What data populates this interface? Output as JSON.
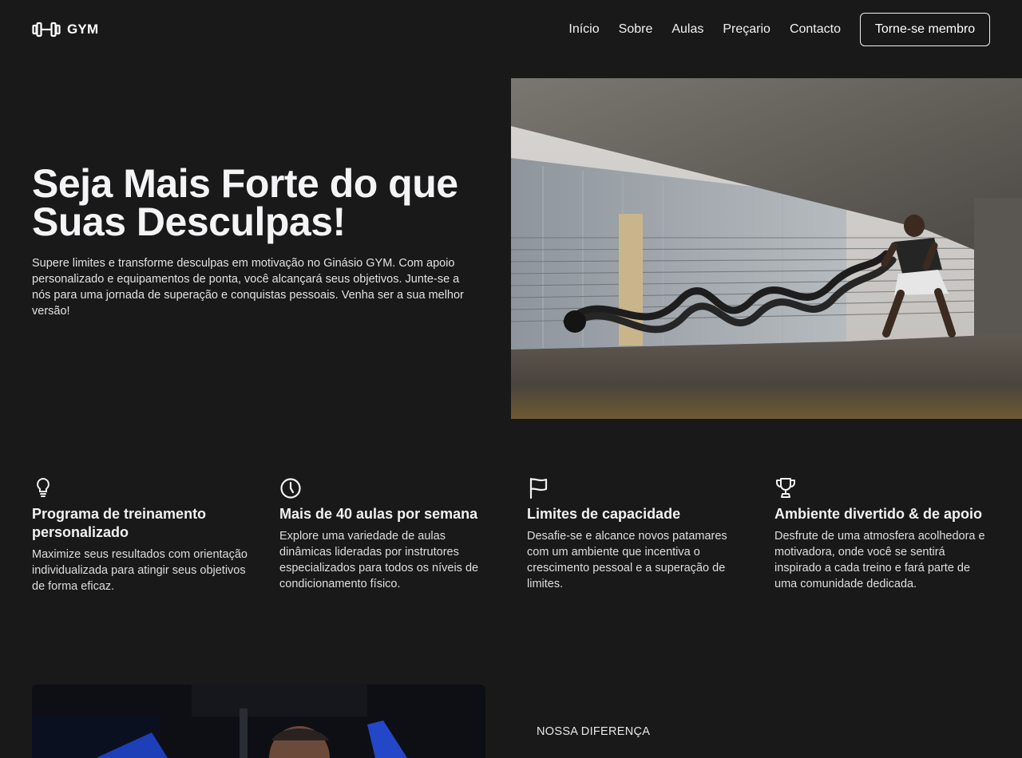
{
  "brand": {
    "name": "GYM",
    "icon": "dumbbell-icon"
  },
  "nav": {
    "items": [
      {
        "label": "Início"
      },
      {
        "label": "Sobre"
      },
      {
        "label": "Aulas"
      },
      {
        "label": "Preçario"
      },
      {
        "label": "Contacto"
      }
    ],
    "cta_label": "Torne-se membro"
  },
  "hero": {
    "title": "Seja Mais Forte do que Suas Desculpas!",
    "text": "Supere limites e transforme desculpas em motivação no Ginásio GYM. Com apoio personalizado e equipamentos de ponta, você alcançará seus objetivos. Junte-se a nós para uma jornada de superação e conquistas pessoais. Venha ser a sua melhor versão!",
    "image": "battle-ropes-athlete-photo"
  },
  "features": [
    {
      "icon": "lightbulb-icon",
      "title": "Programa de treinamento personalizado",
      "text": "Maximize seus resultados com orientação individualizada para atingir seus objetivos de forma eficaz."
    },
    {
      "icon": "clock-icon",
      "title": "Mais de 40 aulas por semana",
      "text": "Explore uma variedade de aulas dinâmicas lideradas por instrutores especializados para todos os níveis de condicionamento físico."
    },
    {
      "icon": "flag-icon",
      "title": "Limites de capacidade",
      "text": "Desafie-se e alcance novos patamares com um ambiente que incentiva o crescimento pessoal e a superação de limites."
    },
    {
      "icon": "trophy-icon",
      "title": "Ambiente divertido & de apoio",
      "text": "Desfrute de uma atmosfera acolhedora e motivadora, onde você se sentirá inspirado a cada treino e fará parte de uma comunidade dedicada."
    }
  ],
  "difference": {
    "eyebrow": "NOSSA DIFERENÇA",
    "image": "gym-trainer-photo"
  },
  "colors": {
    "background": "#191919",
    "text": "#f4f4f6",
    "accent_border": "#f0f0f0"
  }
}
